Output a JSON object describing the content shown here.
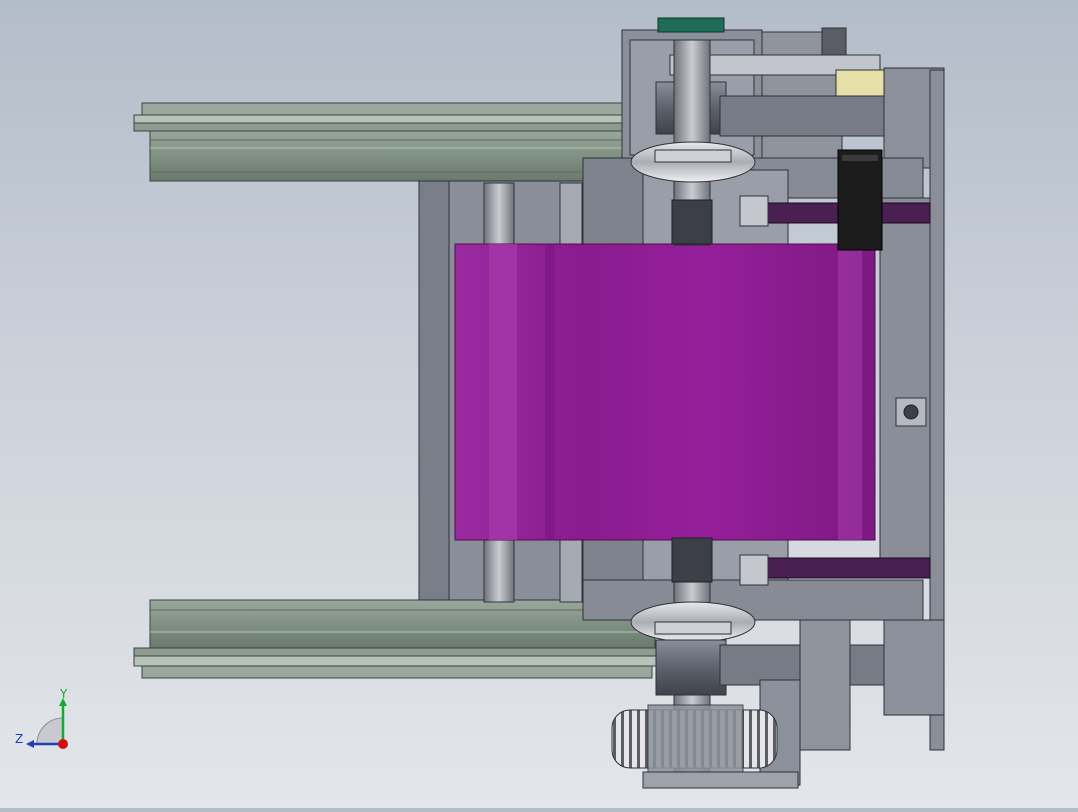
{
  "viewport": {
    "colors": {
      "roll": "#8e2193",
      "rail": "#7f9182",
      "frame": "#7b7f8c",
      "motor": "#1c1c1c",
      "label": "#e6e0a8",
      "teal_cap": "#1f6d58",
      "bar": "#4a1f52"
    }
  },
  "triad": {
    "y_label": "Y",
    "z_label": "Z",
    "colors": {
      "y": "#15a832",
      "z": "#1f3fb5",
      "x": "#d01010"
    }
  }
}
